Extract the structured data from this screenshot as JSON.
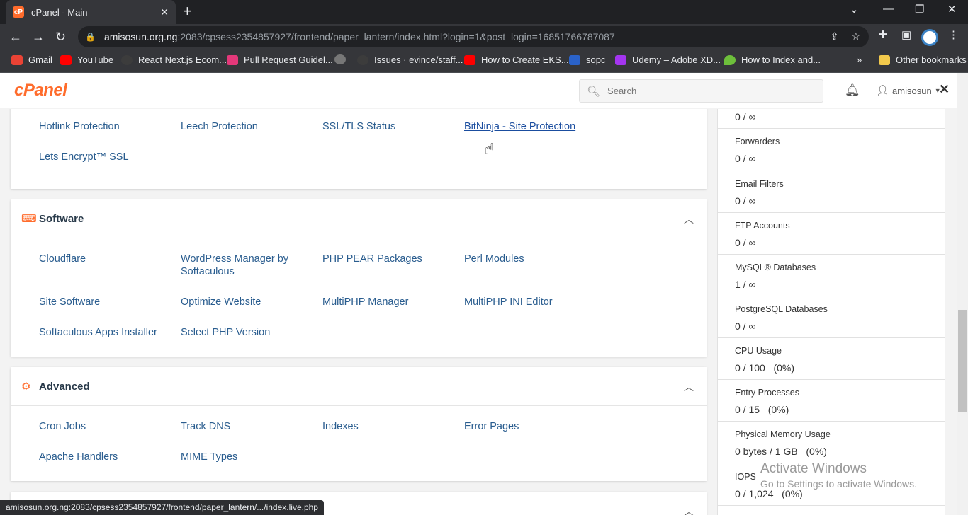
{
  "browser": {
    "tab_title": "cPanel - Main",
    "tab_favicon": "cP",
    "url_host": "amisosun.org.ng",
    "url_rest": ":2083/cpsess2354857927/frontend/paper_lantern/index.html?login=1&post_login=16851766787087",
    "bookmarks": [
      "Gmail",
      "YouTube",
      "React Next.js Ecom...",
      "Pull Request Guidel...",
      "Issues · evince/staff...",
      "How to Create EKS...",
      "sopc",
      "Udemy – Adobe XD...",
      "How to Index and..."
    ],
    "other_bookmarks": "Other bookmarks",
    "more_bookmarks": "»",
    "status_url": "amisosun.org.ng:2083/cpsess2354857927/frontend/paper_lantern/.../index.live.php"
  },
  "header": {
    "logo": "cPanel",
    "search_placeholder": "Search",
    "username": "amisosun"
  },
  "security": {
    "items": [
      "Hotlink Protection",
      "Leech Protection",
      "SSL/TLS Status",
      "BitNinja - Site Protection",
      "Lets Encrypt™ SSL"
    ]
  },
  "software": {
    "title": "Software",
    "items": [
      "Cloudflare",
      "WordPress Manager by Softaculous",
      "PHP PEAR Packages",
      "Perl Modules",
      "Site Software",
      "Optimize Website",
      "MultiPHP Manager",
      "MultiPHP INI Editor",
      "Softaculous Apps Installer",
      "Select PHP Version"
    ]
  },
  "advanced": {
    "title": "Advanced",
    "items": [
      "Cron Jobs",
      "Track DNS",
      "Indexes",
      "Error Pages",
      "Apache Handlers",
      "MIME Types"
    ]
  },
  "stats": [
    {
      "label": "",
      "value": "0 / ∞"
    },
    {
      "label": "Forwarders",
      "value": "0 / ∞"
    },
    {
      "label": "Email Filters",
      "value": "0 / ∞"
    },
    {
      "label": "FTP Accounts",
      "value": "0 / ∞"
    },
    {
      "label": "MySQL® Databases",
      "value": "1 / ∞"
    },
    {
      "label": "PostgreSQL Databases",
      "value": "0 / ∞"
    },
    {
      "label": "CPU Usage",
      "value": "0 / 100   (0%)"
    },
    {
      "label": "Entry Processes",
      "value": "0 / 15   (0%)"
    },
    {
      "label": "Physical Memory Usage",
      "value": "0 bytes / 1 GB   (0%)"
    },
    {
      "label": "IOPS",
      "value": "0 / 1,024   (0%)"
    }
  ],
  "watermark": {
    "line1": "Activate Windows",
    "line2": "Go to Settings to activate Windows."
  }
}
